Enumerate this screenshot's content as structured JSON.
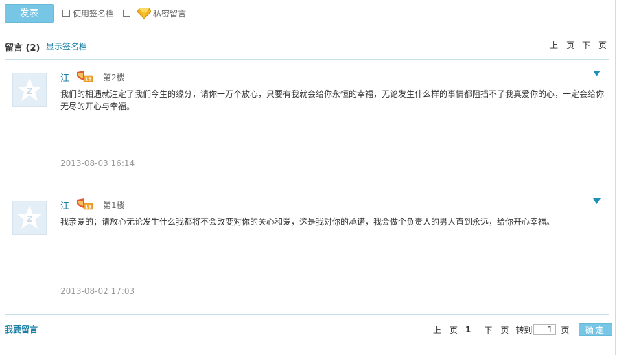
{
  "toolbar": {
    "publish_label": "发表",
    "use_signature_label": "使用签名档",
    "private_message_label": "私密留言"
  },
  "header": {
    "title": "留言 (2)",
    "show_signature_link": "显示签名档",
    "prev_label": "上一页",
    "next_label": "下一页"
  },
  "comments": [
    {
      "author": "江",
      "floor": "第2楼",
      "content": "我们的相遇就注定了我们今生的缘分，请你一万个放心，只要有我就会给你永恒的幸福，无论发生什么样的事情都阻挡不了我真爱你的心，一定会给你无尽的开心与幸福。",
      "time": "2013-08-03 16:14"
    },
    {
      "author": "江",
      "floor": "第1楼",
      "content": "我亲爱的；请放心无论发生什么我都将不会改变对你的关心和爱，这是我对你的承诺，我会做个负责人的男人直到永远，给你开心幸福。",
      "time": "2013-08-02 17:03"
    }
  ],
  "footer": {
    "leave_message_link": "我要留言",
    "prev_label": "上一页",
    "current_page": "1",
    "next_label": "下一页",
    "goto_label": "转到",
    "page_input_value": "1",
    "page_unit_label": "页",
    "confirm_label": "确定"
  },
  "colors": {
    "accent": "#78c6e6",
    "link": "#1b7fa6",
    "separator": "#c6e1ec"
  }
}
